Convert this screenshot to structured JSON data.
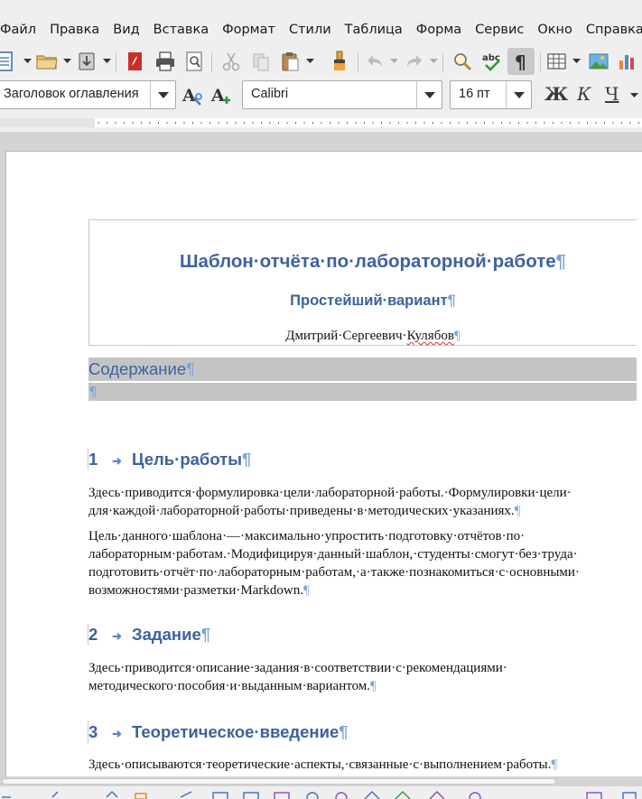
{
  "menu": [
    "Файл",
    "Правка",
    "Вид",
    "Вставка",
    "Формат",
    "Стили",
    "Таблица",
    "Форма",
    "Сервис",
    "Окно",
    "Справка"
  ],
  "formatting": {
    "paragraph_style": "Заголовок оглавления",
    "font_name": "Calibri",
    "font_size": "16 пт",
    "bold_label": "Ж",
    "italic_label": "К",
    "underline_label": "Ч"
  },
  "toolbar_icons": [
    "new-document-icon",
    "open-folder-icon",
    "save-icon",
    "export-pdf-icon",
    "print-icon",
    "print-preview-icon",
    "cut-icon",
    "copy-icon",
    "paste-icon",
    "clone-formatting-icon",
    "undo-icon",
    "redo-icon",
    "find-replace-icon",
    "spellcheck-icon",
    "formatting-marks-icon",
    "insert-table-icon",
    "insert-image-icon",
    "insert-chart-icon"
  ],
  "document": {
    "title": "Шаблон·отчёта·по·лабораторной·работе",
    "subtitle": "Простейший·вариант",
    "author_first": "Дмитрий·Сергеевич·",
    "author_last": "Кулябов",
    "pilcrow": "¶",
    "toc_heading": "Содержание",
    "sections": [
      {
        "number": "1",
        "title": "Цель·работы",
        "paragraphs": [
          [
            "Здесь·приводится·формулировка·цели·лабораторной·работы.·Формулировки·цели·",
            "для·каждой·лабораторной·работы·приведены·в·методических·указаниях."
          ],
          [
            "Цель·данного·шаблона·—·максимально·упростить·подготовку·отчётов·по·",
            "лабораторным·работам.·Модифицируя·данный·шаблон,·студенты·смогут·без·труда·",
            "подготовить·отчёт·по·лабораторным·работам,·а·также·познакомиться·с·основными·",
            "возможностями·разметки·Markdown."
          ]
        ]
      },
      {
        "number": "2",
        "title": "Задание",
        "paragraphs": [
          [
            "Здесь·приводится·описание·задания·в·соответствии·с·рекомендациями·",
            "методического·пособия·и·выданным·вариантом."
          ]
        ]
      },
      {
        "number": "3",
        "title": "Теоретическое·введение",
        "paragraphs": [
          [
            "Здесь·описываются·теоретические·аспекты,·связанные·с·выполнением·работы."
          ]
        ]
      }
    ]
  }
}
